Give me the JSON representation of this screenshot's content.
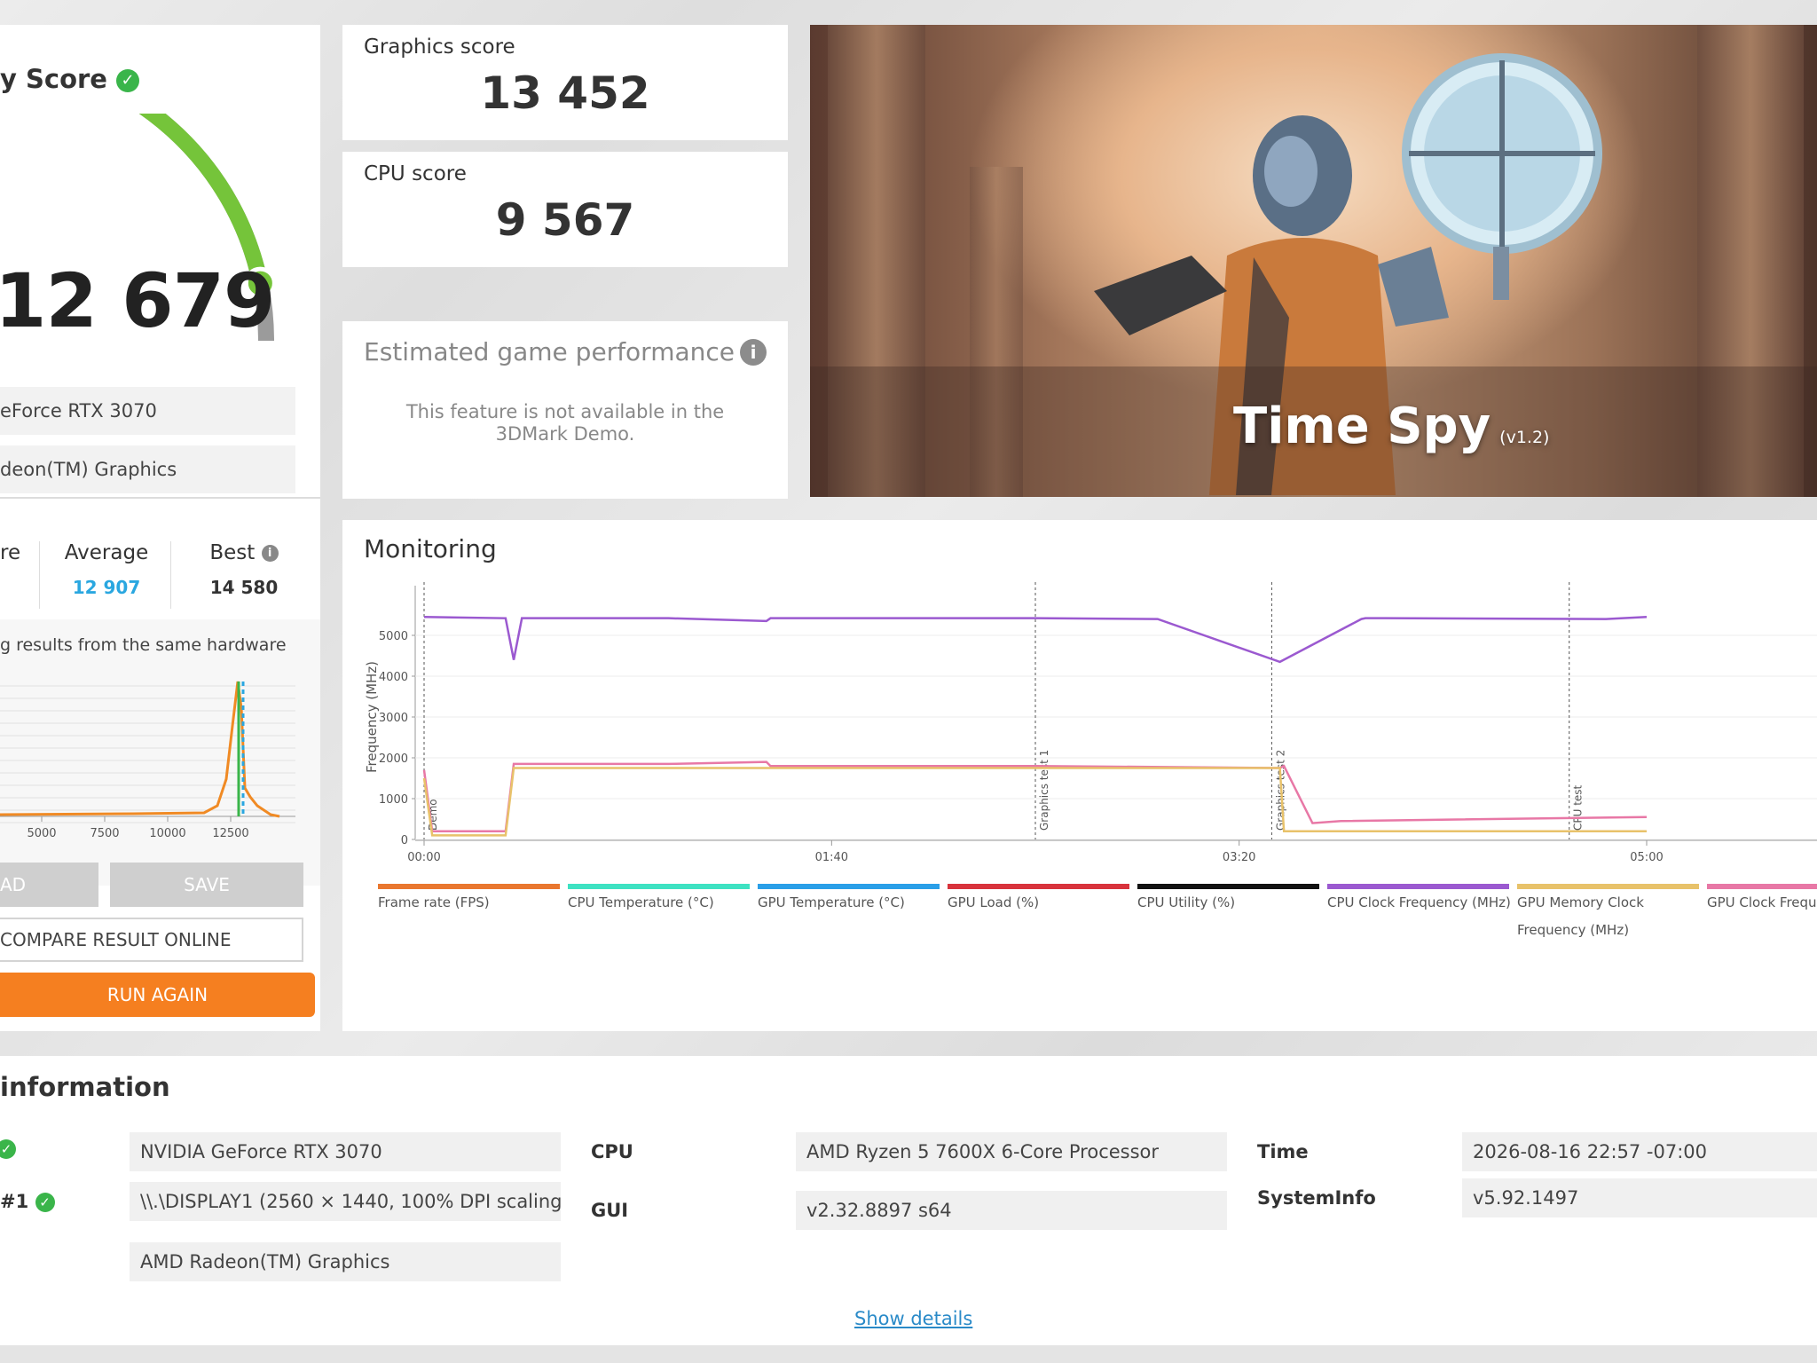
{
  "score_panel": {
    "title": "y Score",
    "total_score": "12 679",
    "gauge_fraction": 0.87,
    "hardware": [
      "eForce RTX 3070",
      "deon(TM) Graphics"
    ],
    "stats": {
      "left_label": "re",
      "average_label": "Average",
      "average_value": "12 907",
      "best_label": "Best",
      "best_value": "14 580"
    },
    "similar_text": "g results from the same hardware",
    "buttons": {
      "load": "AD",
      "save": "SAVE",
      "compare": "COMPARE RESULT ONLINE",
      "run_again": "RUN AGAIN"
    }
  },
  "dist_chart": {
    "type": "line",
    "x_ticks": [
      "5000",
      "7500",
      "10000",
      "12500"
    ],
    "colors": {
      "line": "#f08a24",
      "your_score": "#3ab54a",
      "average": "#2aa7e0"
    }
  },
  "graphics_card": {
    "label": "Graphics score",
    "value": "13 452"
  },
  "cpu_card": {
    "label": "CPU score",
    "value": "9 567"
  },
  "estimated": {
    "title": "Estimated game performance",
    "message": "This feature is not available in the 3DMark Demo."
  },
  "hero": {
    "title": "Time Spy",
    "version": "(v1.2)"
  },
  "monitoring": {
    "title": "Monitoring",
    "y_label": "Frequency (MHz)",
    "y_ticks": [
      "0",
      "1000",
      "2000",
      "3000",
      "4000",
      "5000"
    ],
    "x_ticks": [
      "00:00",
      "01:40",
      "03:20",
      "05:00"
    ],
    "markers": [
      "Demo",
      "Graphics test 1",
      "Graphics test 2",
      "CPU test"
    ],
    "legend": [
      {
        "label": "Frame rate (FPS)",
        "color": "#e9772f"
      },
      {
        "label": "CPU Temperature (°C)",
        "color": "#3ee2c2"
      },
      {
        "label": "GPU Temperature (°C)",
        "color": "#2a9fe8"
      },
      {
        "label": "GPU Load (%)",
        "color": "#d8333c"
      },
      {
        "label": "CPU Utility (%)",
        "color": "#111111"
      },
      {
        "label": "CPU Clock Frequency (MHz)",
        "color": "#9b59d0"
      },
      {
        "label": "GPU Memory Clock Frequency (MHz)",
        "color": "#e8c26a"
      },
      {
        "label": "GPU Clock Freque",
        "color": "#e878a6"
      }
    ]
  },
  "chart_data": {
    "type": "line",
    "title": "Monitoring",
    "ylabel": "Frequency (MHz)",
    "ylim": [
      0,
      6000
    ],
    "x_ticks": [
      "00:00",
      "01:40",
      "03:20",
      "05:00"
    ],
    "series": [
      {
        "name": "CPU Clock Frequency (MHz)",
        "x": [
          0,
          20,
          22,
          24,
          60,
          84,
          85,
          95,
          150,
          180,
          210,
          230,
          231,
          236,
          290,
          300
        ],
        "values": [
          5450,
          5420,
          4400,
          5420,
          5420,
          5350,
          5420,
          5420,
          5420,
          5400,
          4350,
          5400,
          5420,
          5420,
          5400,
          5450
        ]
      },
      {
        "name": "GPU Clock Frequency (MHz)",
        "x": [
          0,
          2,
          10,
          20,
          22,
          60,
          84,
          85,
          150,
          210,
          211,
          218,
          225,
          300
        ],
        "values": [
          1700,
          200,
          200,
          200,
          1850,
          1850,
          1900,
          1800,
          1800,
          1750,
          1800,
          400,
          450,
          550
        ]
      },
      {
        "name": "GPU Memory Clock Frequency (MHz)",
        "x": [
          0,
          2,
          20,
          22,
          210,
          211,
          300
        ],
        "values": [
          1500,
          100,
          100,
          1750,
          1750,
          200,
          200
        ]
      }
    ]
  },
  "sysinfo": {
    "title": "information",
    "gpu1": "NVIDIA GeForce RTX 3070",
    "display_label": "#1",
    "display": "\\\\.\\DISPLAY1 (2560 × 1440, 100% DPI scaling)",
    "gpu2": "AMD Radeon(TM) Graphics",
    "cpu_label": "CPU",
    "cpu": "AMD Ryzen 5 7600X 6-Core Processor",
    "gui_label": "GUI",
    "gui": "v2.32.8897 s64",
    "time_label": "Time",
    "time": "2026-08-16 22:57 -07:00",
    "systeminfo_label": "SystemInfo",
    "systeminfo": "v5.92.1497",
    "show_details": "Show details"
  }
}
